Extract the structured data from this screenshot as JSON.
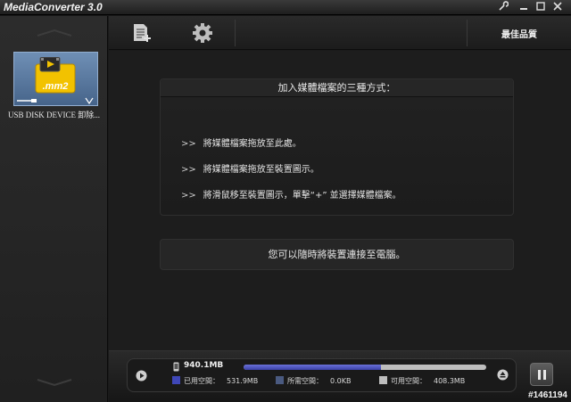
{
  "window": {
    "title": "MediaConverter 3.0"
  },
  "toolbar": {
    "quality_label": "最佳品質",
    "add_file_icon": "add-document-icon",
    "settings_icon": "gear-icon"
  },
  "sidebar": {
    "device_badge": ".mm2",
    "device_name": "USB DISK DEVICE 卸除..."
  },
  "info": {
    "title": "加入媒體檔案的三種方式：",
    "marker": ">>",
    "lines": [
      "將媒體檔案拖放至此處。",
      "將媒體檔案拖放至裝置圖示。",
      "將滑鼠移至裝置圖示，單擊“+” 並選擇媒體檔案。"
    ]
  },
  "connect_message": "您可以隨時將裝置連接至電腦。",
  "storage": {
    "total": "940.1MB",
    "used_fraction": 0.566,
    "used": {
      "label": "已用空間：",
      "value": "531.9MB",
      "color": "#3f47b8"
    },
    "needed": {
      "label": "所需空間：",
      "value": "0.0KB",
      "color": "#4a5a80"
    },
    "free": {
      "label": "可用空間：",
      "value": "408.3MB",
      "color": "#bdbdbd"
    }
  },
  "watermark": "#1461194"
}
